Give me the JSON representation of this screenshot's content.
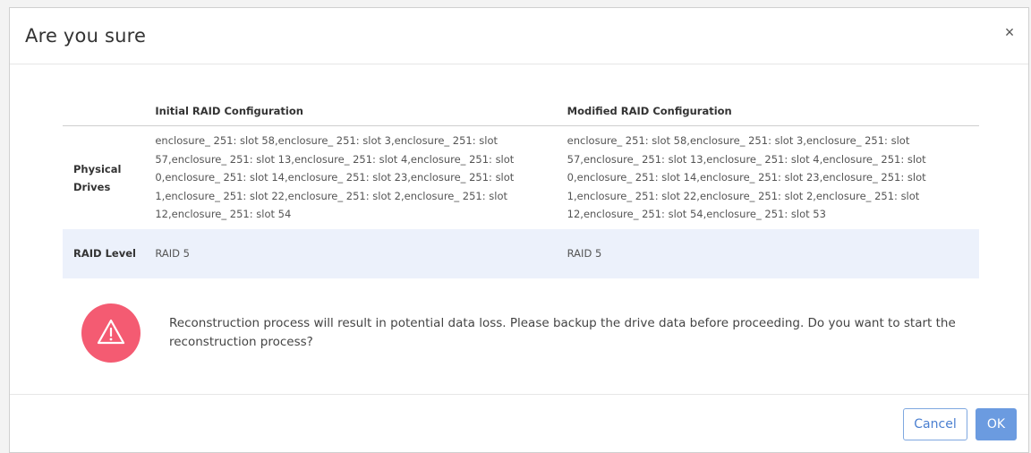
{
  "dialog": {
    "title": "Are you sure",
    "close_label": "×"
  },
  "table": {
    "headers": [
      "",
      "Initial RAID Configuration",
      "Modified RAID Configuration"
    ],
    "rows": [
      {
        "label": "Physical Drives",
        "initial": "enclosure_ 251: slot 58,enclosure_ 251: slot 3,enclosure_ 251: slot 57,enclosure_ 251: slot 13,enclosure_ 251: slot 4,enclosure_ 251: slot 0,enclosure_ 251: slot 14,enclosure_ 251: slot 23,enclosure_ 251: slot 1,enclosure_ 251: slot 22,enclosure_ 251: slot 2,enclosure_ 251: slot 12,enclosure_ 251: slot 54",
        "modified": "enclosure_ 251: slot 58,enclosure_ 251: slot 3,enclosure_ 251: slot 57,enclosure_ 251: slot 13,enclosure_ 251: slot 4,enclosure_ 251: slot 0,enclosure_ 251: slot 14,enclosure_ 251: slot 23,enclosure_ 251: slot 1,enclosure_ 251: slot 22,enclosure_ 251: slot 2,enclosure_ 251: slot 12,enclosure_ 251: slot 54,enclosure_ 251: slot 53"
      },
      {
        "label": "RAID Level",
        "initial": "RAID 5",
        "modified": "RAID 5"
      }
    ]
  },
  "warning": {
    "icon": "warning-triangle-icon",
    "color": "#f45b72",
    "message": "Reconstruction process will result in potential data loss. Please backup the drive data before proceeding. Do you want to start the reconstruction process?"
  },
  "footer": {
    "cancel_label": "Cancel",
    "ok_label": "OK"
  }
}
